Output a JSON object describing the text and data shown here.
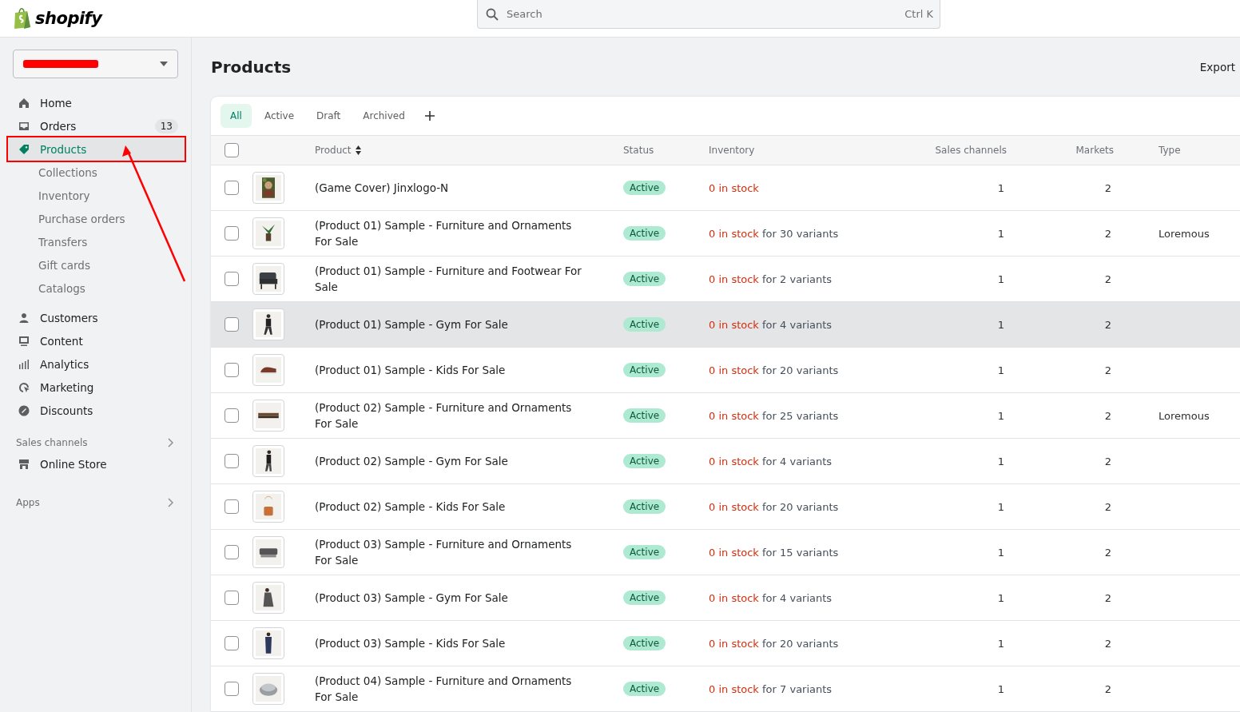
{
  "topbar": {
    "logo": "shopify",
    "search": {
      "placeholder": "Search",
      "shortcut": "Ctrl K"
    }
  },
  "sidebar": {
    "store_selector": {
      "redacted": true
    },
    "items": [
      {
        "label": "Home",
        "selected": false
      },
      {
        "label": "Orders",
        "badge": "13",
        "selected": false
      },
      {
        "label": "Products",
        "selected": true,
        "children": [
          {
            "label": "Collections",
            "selected": false
          },
          {
            "label": "Inventory",
            "selected": false
          },
          {
            "label": "Purchase orders",
            "selected": false
          },
          {
            "label": "Transfers",
            "selected": false
          },
          {
            "label": "Gift cards",
            "selected": false
          },
          {
            "label": "Catalogs",
            "selected": false
          }
        ]
      },
      {
        "label": "Customers",
        "selected": false
      },
      {
        "label": "Content",
        "selected": false
      },
      {
        "label": "Analytics",
        "selected": false
      },
      {
        "label": "Marketing",
        "selected": false
      },
      {
        "label": "Discounts",
        "selected": false
      }
    ],
    "sections": [
      {
        "title": "Sales channels",
        "items": [
          {
            "label": "Online Store",
            "selected": false
          }
        ]
      },
      {
        "title": "Apps"
      }
    ]
  },
  "page": {
    "title": "Products",
    "actions": [
      "Export"
    ]
  },
  "tabs": [
    {
      "label": "All",
      "selected": true
    },
    {
      "label": "Active",
      "selected": false
    },
    {
      "label": "Draft",
      "selected": false
    },
    {
      "label": "Archived",
      "selected": false
    }
  ],
  "table": {
    "all_selected": false,
    "columns": [
      "Product",
      "Status",
      "Inventory",
      "Sales channels",
      "Markets",
      "Type"
    ],
    "rows": [
      {
        "name": "(Game Cover) Jinxlogo-N",
        "status": "Active",
        "stock": "0 in stock",
        "channels": "1",
        "markets": "2",
        "checked": false,
        "hovered": false
      },
      {
        "name": "(Product 01) Sample - Furniture and Ornaments For Sale",
        "status": "Active",
        "stock": "0 in stock",
        "variants": "for 30 variants",
        "channels": "1",
        "markets": "2",
        "type": "Loremous",
        "checked": false,
        "hovered": false
      },
      {
        "name": "(Product 01) Sample - Furniture and Footwear For Sale",
        "status": "Active",
        "stock": "0 in stock",
        "variants": "for 2 variants",
        "channels": "1",
        "markets": "2",
        "checked": false,
        "hovered": false
      },
      {
        "name": "(Product 01) Sample - Gym For Sale",
        "status": "Active",
        "stock": "0 in stock",
        "variants": "for 4 variants",
        "channels": "1",
        "markets": "2",
        "checked": false,
        "hovered": true
      },
      {
        "name": "(Product 01) Sample - Kids For Sale",
        "status": "Active",
        "stock": "0 in stock",
        "variants": "for 20 variants",
        "channels": "1",
        "markets": "2",
        "checked": false,
        "hovered": false
      },
      {
        "name": "(Product 02) Sample - Furniture and Ornaments For Sale",
        "status": "Active",
        "stock": "0 in stock",
        "variants": "for 25 variants",
        "channels": "1",
        "markets": "2",
        "type": "Loremous",
        "checked": false,
        "hovered": false
      },
      {
        "name": "(Product 02) Sample - Gym For Sale",
        "status": "Active",
        "stock": "0 in stock",
        "variants": "for 4 variants",
        "channels": "1",
        "markets": "2",
        "checked": false,
        "hovered": false
      },
      {
        "name": "(Product 02) Sample - Kids For Sale",
        "status": "Active",
        "stock": "0 in stock",
        "variants": "for 20 variants",
        "channels": "1",
        "markets": "2",
        "checked": false,
        "hovered": false
      },
      {
        "name": "(Product 03) Sample - Furniture and Ornaments For Sale",
        "status": "Active",
        "stock": "0 in stock",
        "variants": "for 15 variants",
        "channels": "1",
        "markets": "2",
        "checked": false,
        "hovered": false
      },
      {
        "name": "(Product 03) Sample - Gym For Sale",
        "status": "Active",
        "stock": "0 in stock",
        "variants": "for 4 variants",
        "channels": "1",
        "markets": "2",
        "checked": false,
        "hovered": false
      },
      {
        "name": "(Product 03) Sample - Kids For Sale",
        "status": "Active",
        "stock": "0 in stock",
        "variants": "for 20 variants",
        "channels": "1",
        "markets": "2",
        "checked": false,
        "hovered": false
      },
      {
        "name": "(Product 04) Sample - Furniture and Ornaments For Sale",
        "status": "Active",
        "stock": "0 in stock",
        "variants": "for 7 variants",
        "channels": "1",
        "markets": "2",
        "checked": false,
        "hovered": false
      }
    ]
  }
}
